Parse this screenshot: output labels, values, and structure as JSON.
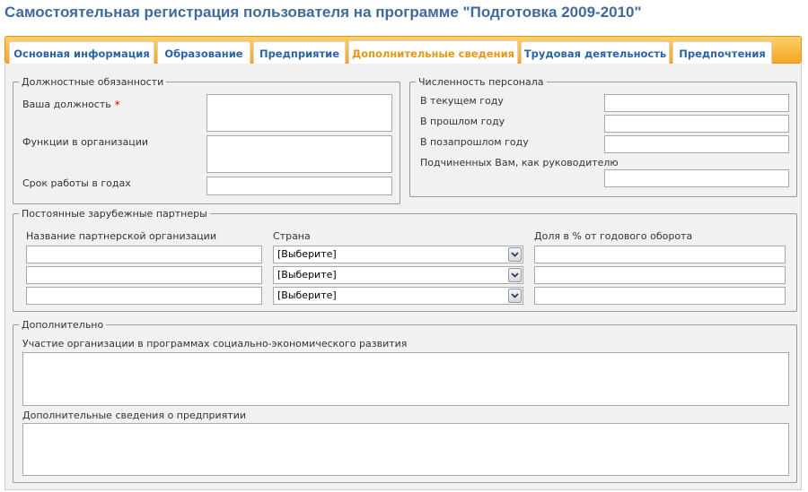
{
  "page": {
    "title": "Самостоятельная регистрация пользователя на программе \"Подготовка 2009-2010\""
  },
  "tabs": [
    {
      "label": "Основная информация"
    },
    {
      "label": "Образование"
    },
    {
      "label": "Предприятие"
    },
    {
      "label": "Дополнительные сведения",
      "active": true
    },
    {
      "label": "Трудовая деятельность"
    },
    {
      "label": "Предпочтения"
    }
  ],
  "duties": {
    "legend": "Должностные обязанности",
    "position_label": "Ваша должность",
    "required_mark": "*",
    "position_value": "",
    "functions_label": "Функции в организации",
    "functions_value": "",
    "years_label": "Срок работы в годах",
    "years_value": ""
  },
  "staff": {
    "legend": "Численность персонала",
    "current_year_label": "В текущем году",
    "last_year_label": "В прошлом году",
    "year_before_label": "В позапрошлом году",
    "subordinates_label": "Подчиненных Вам, как руководителю",
    "current_year_value": "",
    "last_year_value": "",
    "year_before_value": "",
    "subordinates_value": ""
  },
  "partners": {
    "legend": "Постоянные зарубежные партнеры",
    "col_name": "Название партнерской организации",
    "col_country": "Страна",
    "col_share": "Доля в % от годового оборота",
    "rows": [
      {
        "name": "",
        "country": "[Выберите]",
        "share": ""
      },
      {
        "name": "",
        "country": "[Выберите]",
        "share": ""
      },
      {
        "name": "",
        "country": "[Выберите]",
        "share": ""
      }
    ]
  },
  "extra": {
    "legend": "Дополнительно",
    "programs_label": "Участие организации в программах социально-экономического развития",
    "programs_value": "",
    "info_label": "Дополнительные сведения о предприятии",
    "info_value": ""
  },
  "colors": {
    "title": "#3f6a9b",
    "tab_text": "#2a64a6",
    "tab_active": "#e8961b",
    "tab_bar": "#f5a623",
    "required": "#ee0000"
  },
  "icons": {
    "select_arrow": "chevron-down-icon"
  }
}
